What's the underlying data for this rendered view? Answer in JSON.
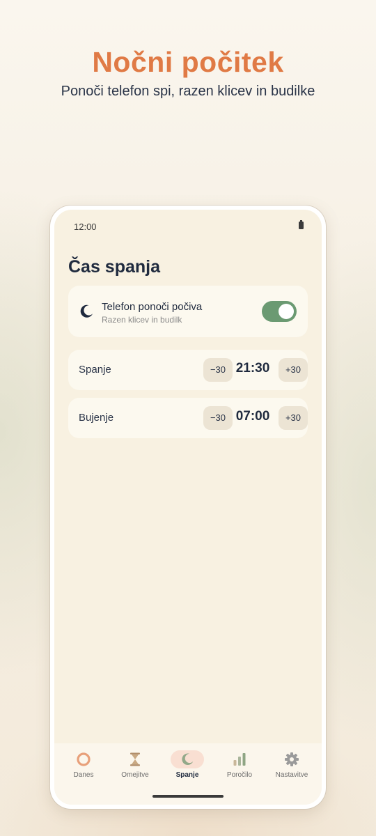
{
  "promo": {
    "headline": "Nočni počitek",
    "subline": "Ponoči telefon spi, razen klicev in budilke"
  },
  "status_bar": {
    "time": "12:00",
    "battery_icon": "battery-icon"
  },
  "page": {
    "title": "Čas spanja"
  },
  "sleep_toggle": {
    "icon": "moon-icon",
    "title": "Telefon ponoči počiva",
    "subtitle": "Razen klicev in budilk",
    "enabled": true
  },
  "schedule": [
    {
      "label": "Spanje",
      "minus_label": "−30",
      "time": "21:30",
      "plus_label": "+30"
    },
    {
      "label": "Bujenje",
      "minus_label": "−30",
      "time": "07:00",
      "plus_label": "+30"
    }
  ],
  "nav": {
    "items": [
      {
        "label": "Danes",
        "icon": "ring-icon",
        "active": false
      },
      {
        "label": "Omejitve",
        "icon": "hourglass-icon",
        "active": false
      },
      {
        "label": "Spanje",
        "icon": "moon-icon",
        "active": true
      },
      {
        "label": "Poročilo",
        "icon": "bar-chart-icon",
        "active": false
      },
      {
        "label": "Nastavitve",
        "icon": "gear-icon",
        "active": false
      }
    ]
  },
  "colors": {
    "accent": "#e07a45",
    "toggle_on": "#6b9a72",
    "text_dark": "#1f2a3e",
    "nav_active_bg": "#f9dfd2"
  }
}
